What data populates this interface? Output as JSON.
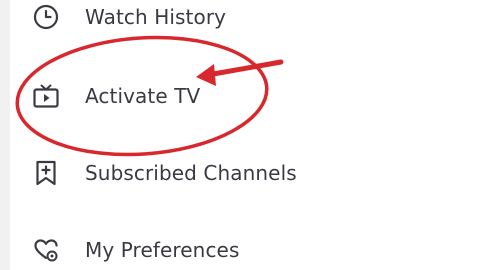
{
  "menu": {
    "items": [
      {
        "label": "Watch History",
        "icon": "clock-icon"
      },
      {
        "label": "Activate TV",
        "icon": "tv-icon"
      },
      {
        "label": "Subscribed Channels",
        "icon": "bookmark-plus-icon"
      },
      {
        "label": "My Preferences",
        "icon": "heart-gear-icon"
      }
    ]
  },
  "annotation": {
    "color": "#d9272e",
    "shape": "ellipse-with-arrow"
  }
}
